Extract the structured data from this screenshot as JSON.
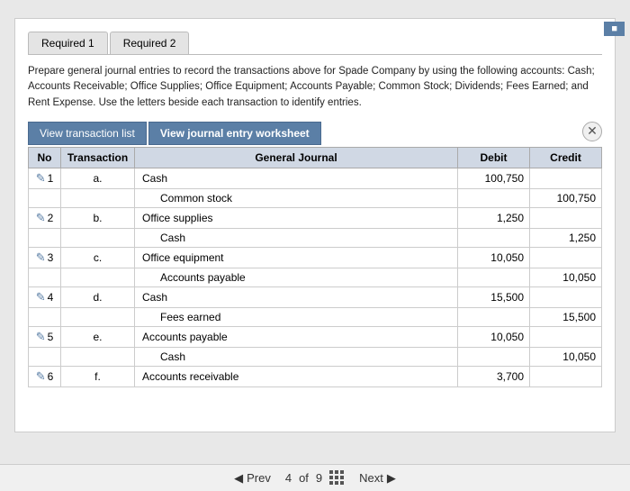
{
  "tabs": [
    {
      "label": "Required 1",
      "active": false
    },
    {
      "label": "Required 2",
      "active": false
    }
  ],
  "instructions": "Prepare general journal entries to record the transactions above for Spade Company by using the following accounts: Cash; Accounts Receivable; Office Supplies; Office Equipment; Accounts Payable; Common Stock; Dividends; Fees Earned; and Rent Expense. Use the letters beside each transaction to identify entries.",
  "buttons": {
    "transaction_list": "View transaction list",
    "journal_worksheet": "View journal entry worksheet"
  },
  "table": {
    "headers": {
      "no": "No",
      "transaction": "Transaction",
      "general_journal": "General Journal",
      "debit": "Debit",
      "credit": "Credit"
    },
    "rows": [
      {
        "no": "1",
        "trans": "a.",
        "account": "Cash",
        "indent": false,
        "debit": "100,750",
        "credit": ""
      },
      {
        "no": "",
        "trans": "",
        "account": "Common stock",
        "indent": true,
        "debit": "",
        "credit": "100,750"
      },
      {
        "no": "2",
        "trans": "b.",
        "account": "Office supplies",
        "indent": false,
        "debit": "1,250",
        "credit": ""
      },
      {
        "no": "",
        "trans": "",
        "account": "Cash",
        "indent": true,
        "debit": "",
        "credit": "1,250"
      },
      {
        "no": "3",
        "trans": "c.",
        "account": "Office equipment",
        "indent": false,
        "debit": "10,050",
        "credit": ""
      },
      {
        "no": "",
        "trans": "",
        "account": "Accounts payable",
        "indent": true,
        "debit": "",
        "credit": "10,050"
      },
      {
        "no": "4",
        "trans": "d.",
        "account": "Cash",
        "indent": false,
        "debit": "15,500",
        "credit": ""
      },
      {
        "no": "",
        "trans": "",
        "account": "Fees earned",
        "indent": true,
        "debit": "",
        "credit": "15,500"
      },
      {
        "no": "5",
        "trans": "e.",
        "account": "Accounts payable",
        "indent": false,
        "debit": "10,050",
        "credit": ""
      },
      {
        "no": "",
        "trans": "",
        "account": "Cash",
        "indent": true,
        "debit": "",
        "credit": "10,050"
      },
      {
        "no": "6",
        "trans": "f.",
        "account": "Accounts receivable",
        "indent": false,
        "debit": "3,700",
        "credit": ""
      }
    ]
  },
  "pagination": {
    "prev_label": "Prev",
    "next_label": "Next",
    "current": "4",
    "total": "9"
  }
}
